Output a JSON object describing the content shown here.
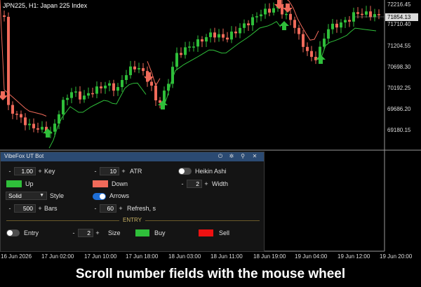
{
  "chart": {
    "title": "JPN225, H1:  Japan 225 Index",
    "price_labels": [
      "72216.45",
      "71710.40",
      "71204.55",
      "70698.30",
      "70192.25",
      "69686.20",
      "69180.15"
    ],
    "current_price": "71854.13",
    "time_labels": [
      "16 Jun 2026",
      "17 Jun 02:00",
      "17 Jun 10:00",
      "17 Jun 18:00",
      "18 Jun 03:00",
      "18 Jun 11:00",
      "18 Jun 19:00",
      "19 Jun 04:00",
      "19 Jun 12:00",
      "19 Jun 20:00"
    ],
    "colors": {
      "bull": "#2fbf3a",
      "bear": "#f06a5a",
      "trail_up": "#2fbf3a",
      "trail_down": "#f06a5a",
      "background": "#000000"
    }
  },
  "panel": {
    "title": "VibeFox UT Bot",
    "header_icons": [
      "power-icon",
      "settings-icon",
      "pin-icon",
      "close-icon"
    ],
    "key": {
      "value": "1.00",
      "label": "Key"
    },
    "atr": {
      "value": "10",
      "label": "ATR"
    },
    "heikin_ashi": {
      "label": "Heikin Ashi",
      "on": false
    },
    "up": {
      "label": "Up",
      "color": "#2fbf3a"
    },
    "down": {
      "label": "Down",
      "color": "#f06a5a"
    },
    "width": {
      "value": "2",
      "label": "Width"
    },
    "style": {
      "value": "Solid",
      "label": "Style"
    },
    "arrows": {
      "label": "Arrows",
      "on": true
    },
    "bars": {
      "value": "500",
      "label": "Bars"
    },
    "refresh": {
      "value": "60",
      "label": "Refresh, s"
    },
    "entry": {
      "heading": "ENTRY",
      "entry_label": "Entry",
      "entry_on": false,
      "size_value": "2",
      "size_label": "Size",
      "buy_label": "Buy",
      "buy_color": "#2fbf3a",
      "sell_label": "Sell",
      "sell_color": "#ee1111"
    }
  },
  "caption": "Scroll number fields with the mouse wheel"
}
